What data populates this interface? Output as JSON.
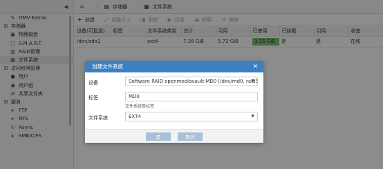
{
  "sidebar": {
    "items": [
      {
        "label": "OMV-Extras",
        "icon": "wrench-icon",
        "type": "child"
      },
      {
        "label": "存储器",
        "icon": "storage-icon",
        "type": "section"
      },
      {
        "label": "物理磁盘",
        "icon": "disk-icon",
        "type": "child"
      },
      {
        "label": "S.M.A.R.T.",
        "icon": "smart-icon",
        "type": "child"
      },
      {
        "label": "RAID管理",
        "icon": "raid-icon",
        "type": "child"
      },
      {
        "label": "文件系统",
        "icon": "filesystem-icon",
        "type": "child",
        "active": true
      },
      {
        "label": "访问权限管理",
        "icon": "access-icon",
        "type": "section"
      },
      {
        "label": "用户",
        "icon": "user-icon",
        "type": "child"
      },
      {
        "label": "用户组",
        "icon": "group-icon",
        "type": "child"
      },
      {
        "label": "共享文件夹",
        "icon": "share-icon",
        "type": "child"
      },
      {
        "label": "服务",
        "icon": "services-icon",
        "type": "section"
      },
      {
        "label": "FTP",
        "icon": "ftp-icon",
        "type": "child"
      },
      {
        "label": "NFS",
        "icon": "nfs-icon",
        "type": "child"
      },
      {
        "label": "Rsync",
        "icon": "rsync-icon",
        "type": "child"
      },
      {
        "label": "SMB/CIFS",
        "icon": "smb-icon",
        "type": "child"
      }
    ]
  },
  "breadcrumb": {
    "home_icon": "home-icon",
    "items": [
      "存储器",
      "文件系统"
    ]
  },
  "toolbar": {
    "buttons": [
      {
        "label": "创建",
        "icon": "plus-icon",
        "enabled": true
      },
      {
        "label": "调整大小",
        "icon": "resize-icon",
        "enabled": false
      },
      {
        "label": "配额",
        "icon": "quota-icon",
        "enabled": false
      },
      {
        "label": "挂载",
        "icon": "mount-icon",
        "enabled": false
      },
      {
        "label": "卸载",
        "icon": "unmount-icon",
        "enabled": false
      },
      {
        "label": "删除",
        "icon": "delete-icon",
        "enabled": false
      }
    ]
  },
  "table": {
    "columns": [
      "设备(可复选)",
      "标签",
      "文件系统类型",
      "总计",
      "可用",
      "已使用",
      "已挂载",
      "引用",
      "状态"
    ],
    "rows": [
      {
        "device": "/dev/sda1",
        "label": "",
        "type": "ext4",
        "total": "7.38 GiB",
        "available": "5.73 GiB",
        "used": "1.25 GiB",
        "used_fraction": 0.17,
        "mounted": "是",
        "referenced": "是",
        "status": "在线"
      }
    ]
  },
  "dialog": {
    "title": "创建文件系统",
    "device_label": "设备",
    "device_value": "Software RAID openmediavault:MD0 [/dev/md0, raid5,",
    "label_label": "标签",
    "label_value": "MD0",
    "label_hint": "文件系统卷标签",
    "fs_label": "文件系统",
    "fs_value": "EXT4",
    "ok_label": "是",
    "cancel_label": "取消"
  },
  "colors": {
    "dialog_header": "#3b80c2",
    "used_bar": "#7ec475",
    "button": "#a8c0d8"
  }
}
